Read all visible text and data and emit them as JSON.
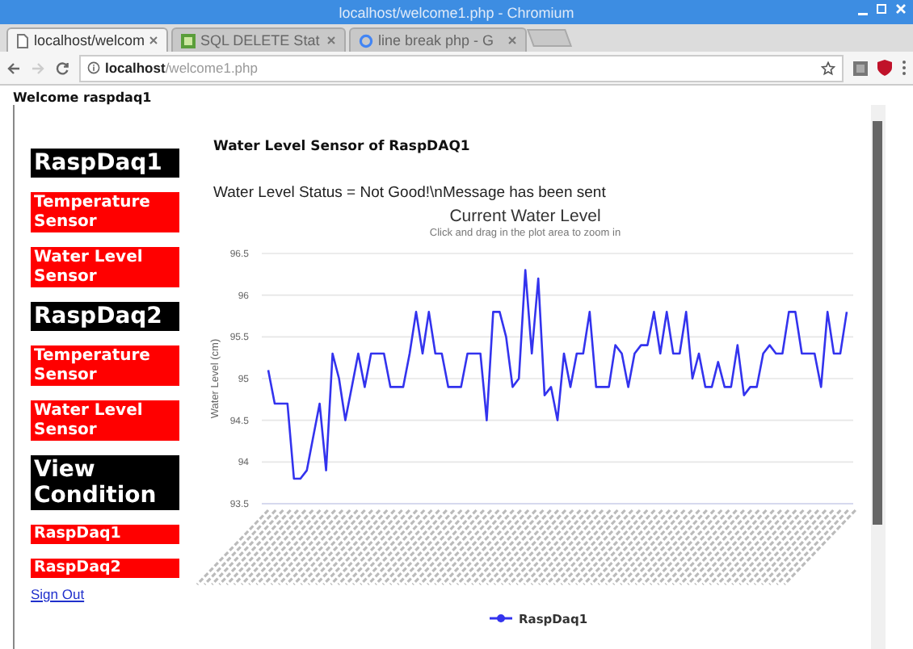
{
  "window": {
    "title": "localhost/welcome1.php - Chromium"
  },
  "tabs": [
    {
      "label": "localhost/welcom",
      "selected": true
    },
    {
      "label": "SQL DELETE Stat",
      "selected": false
    },
    {
      "label": "line break php - G",
      "selected": false
    }
  ],
  "address_bar": {
    "host": "localhost",
    "path": "/welcome1.php"
  },
  "welcome": "Welcome raspdaq1",
  "sidebar": {
    "items": [
      {
        "kind": "header",
        "label": "RaspDaq1"
      },
      {
        "kind": "link",
        "label": "Temperature Sensor"
      },
      {
        "kind": "link",
        "label": "Water Level Sensor"
      },
      {
        "kind": "header",
        "label": "RaspDaq2"
      },
      {
        "kind": "link",
        "label": "Temperature Sensor"
      },
      {
        "kind": "link",
        "label": "Water Level Sensor"
      },
      {
        "kind": "header",
        "label": "View Condition"
      },
      {
        "kind": "small",
        "label": "RaspDaq1"
      },
      {
        "kind": "small",
        "label": "RaspDaq2"
      }
    ],
    "sign_out": "Sign Out"
  },
  "content": {
    "heading": "Water Level Sensor of RaspDAQ1",
    "status": "Water Level Status = Not Good!\\nMessage has been sent",
    "chart": {
      "subtitle": "Click and drag in the plot area to zoom in",
      "chart_data": {
        "type": "line",
        "grid": true,
        "title": "Current Water Level",
        "ylabel": "Water Level (cm)",
        "ylim": [
          93.5,
          96.5
        ],
        "yticks": [
          93.5,
          94,
          94.5,
          95,
          95.5,
          96,
          96.5
        ],
        "series": [
          {
            "name": "RaspDaq1",
            "color": "#3333ee",
            "values": [
              95.1,
              94.7,
              94.7,
              94.7,
              93.8,
              93.8,
              93.9,
              94.3,
              94.7,
              93.9,
              95.3,
              95.0,
              94.5,
              94.9,
              95.3,
              94.9,
              95.3,
              95.3,
              95.3,
              94.9,
              94.9,
              94.9,
              95.3,
              95.8,
              95.3,
              95.8,
              95.3,
              95.3,
              94.9,
              94.9,
              94.9,
              95.3,
              95.3,
              95.3,
              94.5,
              95.8,
              95.8,
              95.5,
              94.9,
              95.0,
              96.3,
              95.3,
              96.2,
              94.8,
              94.9,
              94.5,
              95.3,
              94.9,
              95.3,
              95.3,
              95.8,
              94.9,
              94.9,
              94.9,
              95.4,
              95.3,
              94.9,
              95.3,
              95.4,
              95.4,
              95.8,
              95.3,
              95.8,
              95.3,
              95.3,
              95.8,
              95.0,
              95.3,
              94.9,
              94.9,
              95.2,
              94.9,
              94.9,
              95.4,
              94.8,
              94.9,
              94.9,
              95.3,
              95.4,
              95.3,
              95.3,
              95.8,
              95.8,
              95.3,
              95.3,
              95.3,
              94.9,
              95.8,
              95.3,
              95.3,
              95.8
            ]
          }
        ]
      }
    }
  }
}
